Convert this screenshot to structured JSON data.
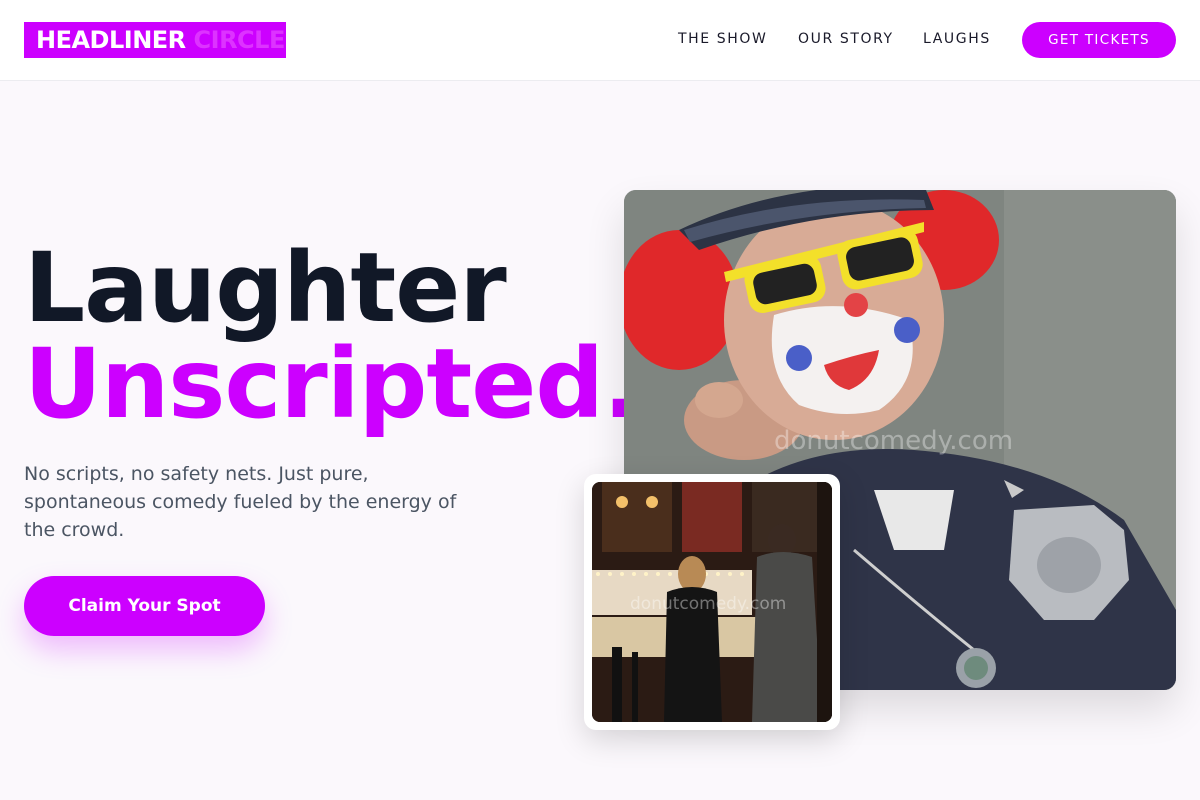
{
  "header": {
    "logo_part1": "HEADLINER",
    "logo_part2": "CIRCLE",
    "nav": [
      {
        "label": "THE SHOW"
      },
      {
        "label": "OUR STORY"
      },
      {
        "label": "LAUGHS"
      }
    ],
    "cta_label": "GET TICKETS"
  },
  "hero": {
    "headline_line1": "Laughter",
    "headline_line2": "Unscripted.",
    "subtitle": "No scripts, no safety nets. Just pure, spontaneous comedy fueled by the energy of the crowd.",
    "cta_label": "Claim Your Spot"
  },
  "images": {
    "main_watermark": "donutcomedy.com",
    "secondary_watermark": "donutcomedy.com"
  },
  "colors": {
    "accent": "#cc00ff",
    "headline_dark": "#111827",
    "background": "#fbf8fc"
  }
}
